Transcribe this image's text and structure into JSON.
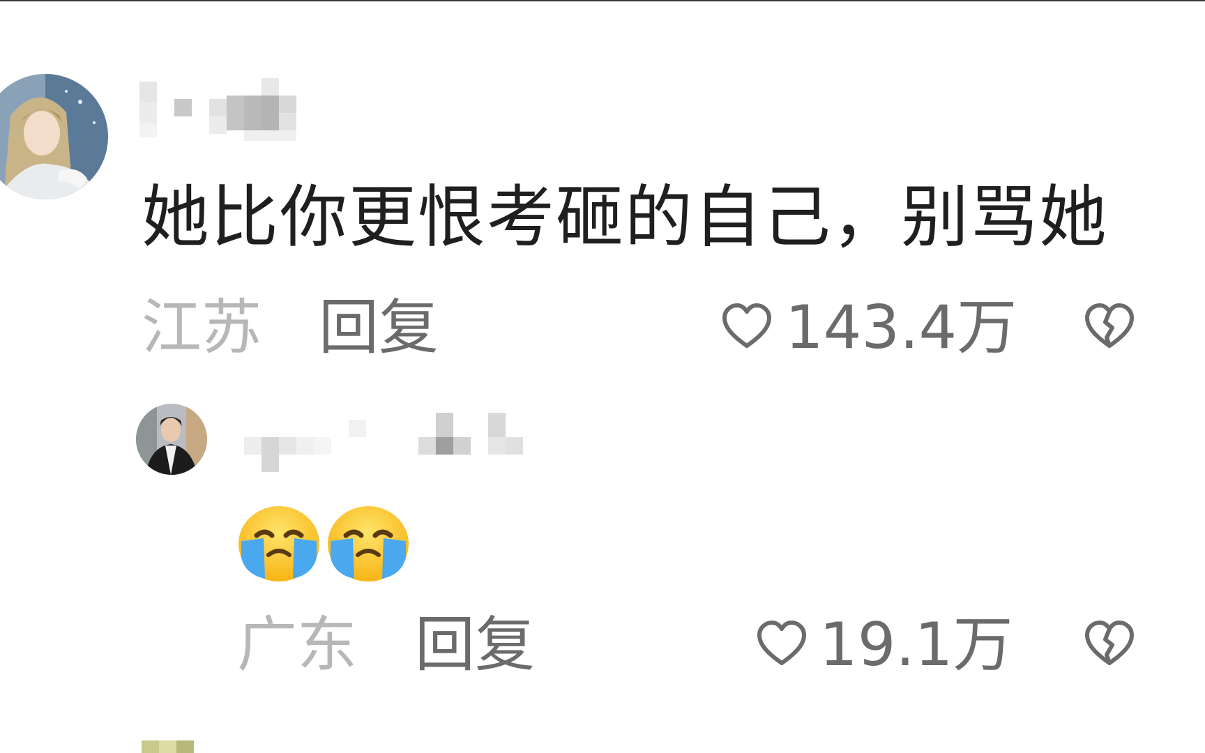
{
  "comment": {
    "text": "她比你更恨考砸的自己，别骂她",
    "location": "江苏",
    "reply_label": "回复",
    "likes": "143.4万",
    "avatar_icon": "anime-character-avatar",
    "like_icon": "heart-outline-icon",
    "dislike_icon": "broken-heart-icon"
  },
  "reply": {
    "emojis": [
      "crying-face-emoji",
      "crying-face-emoji"
    ],
    "location": "广东",
    "reply_label": "回复",
    "likes": "19.1万",
    "avatar_icon": "person-photo-avatar",
    "like_icon": "heart-outline-icon",
    "dislike_icon": "broken-heart-icon"
  },
  "colors": {
    "text_primary": "#1f1f1f",
    "text_location": "#b7b7b7",
    "text_action": "#6b6b6b",
    "background": "#ffffff"
  }
}
